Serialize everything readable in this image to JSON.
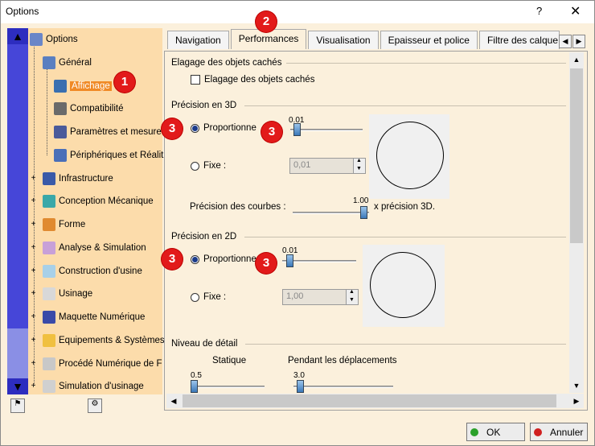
{
  "window": {
    "title": "Options",
    "help": "?",
    "close": "✕"
  },
  "tree": {
    "items": [
      {
        "label": "Options",
        "color": "#6a86c8"
      },
      {
        "label": "Général",
        "color": "#5a7fc0"
      },
      {
        "label": "Affichage",
        "color": "#3a6fb0"
      },
      {
        "label": "Compatibilité",
        "color": "#6a6a6a"
      },
      {
        "label": "Paramètres et mesure",
        "color": "#4a5a9a"
      },
      {
        "label": "Périphériques et Réalit",
        "color": "#4a6fb8"
      },
      {
        "label": "Infrastructure",
        "color": "#3a5aa8"
      },
      {
        "label": "Conception Mécanique",
        "color": "#3aa8a8"
      },
      {
        "label": "Forme",
        "color": "#e08a30"
      },
      {
        "label": "Analyse & Simulation",
        "color": "#c8a0d8"
      },
      {
        "label": "Construction d'usine",
        "color": "#a8d0e8"
      },
      {
        "label": "Usinage",
        "color": "#d8d8d8"
      },
      {
        "label": "Maquette Numérique",
        "color": "#3a4aa8"
      },
      {
        "label": "Equipements & Systèmes",
        "color": "#f0c040"
      },
      {
        "label": "Procédé Numérique de F",
        "color": "#c8c8c8"
      },
      {
        "label": "Simulation d'usinage",
        "color": "#d0d0d0"
      }
    ],
    "scroll_up": "▲",
    "scroll_down": "▼"
  },
  "tabs": [
    "Navigation",
    "Performances",
    "Visualisation",
    "Epaisseur et police",
    "Filtre des calque"
  ],
  "tab_arrows": {
    "left": "◀",
    "right": "▶"
  },
  "elagage": {
    "section": "Elagage des objets cachés",
    "checkbox_label": "Elagage des objets cachés"
  },
  "precision3d": {
    "section": "Précision en 3D",
    "proportional_label": "Proportionne",
    "slider_value": "0.01",
    "slider_level": 0.05,
    "fixed_label": "Fixe :",
    "fixed_value": "0,01",
    "curves_label": "Précision des courbes :",
    "curves_value": "1.00",
    "curves_suffix": "x précision 3D."
  },
  "precision2d": {
    "section": "Précision en 2D",
    "proportional_label": "Proportionne",
    "slider_value": "0.01",
    "slider_level": 0.05,
    "fixed_label": "Fixe :",
    "fixed_value": "1,00"
  },
  "detail": {
    "section": "Niveau de détail",
    "static_label": "Statique",
    "static_value": "0.5",
    "moving_label": "Pendant les déplacements",
    "moving_value": "3.0"
  },
  "badges": [
    "1",
    "2",
    "3",
    "3",
    "3",
    "3"
  ],
  "buttons": {
    "ok": "OK",
    "cancel": "Annuler"
  },
  "colors": {
    "badge": "#e21a1a",
    "selected": "#f08a26",
    "tree_bg": "#fcdcab"
  }
}
